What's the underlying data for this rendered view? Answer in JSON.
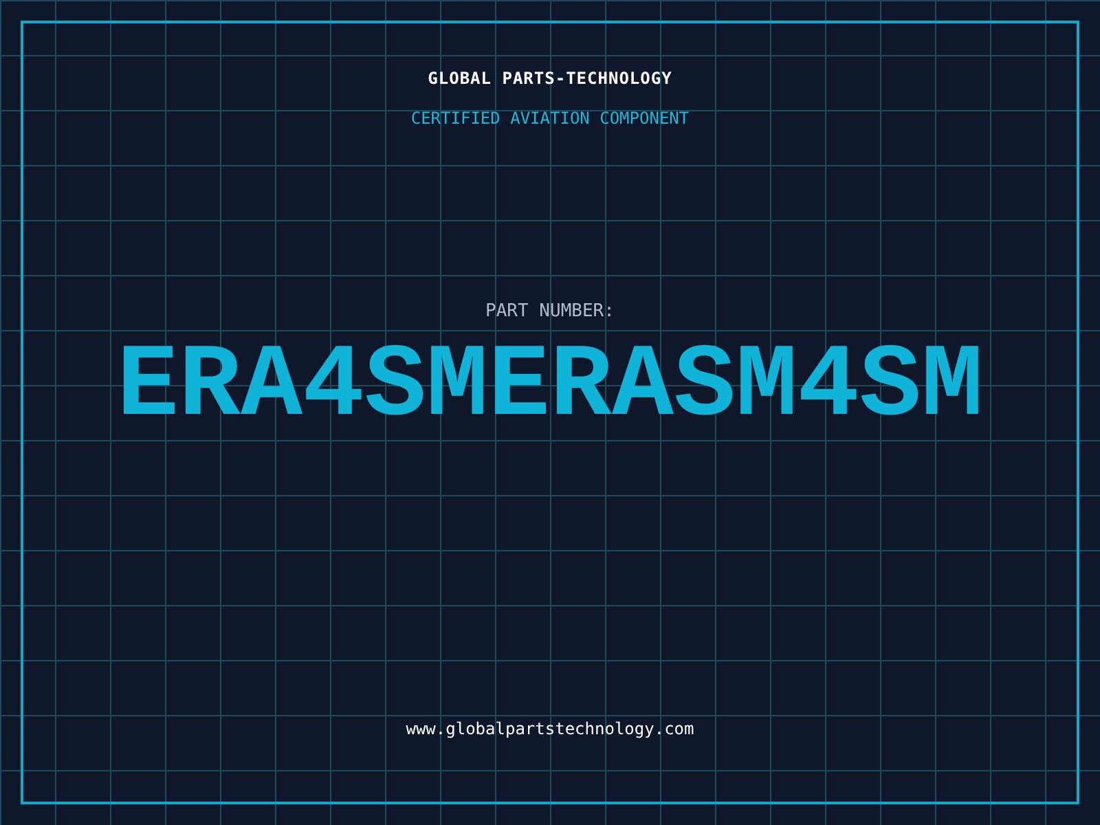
{
  "brand": {
    "title": "GLOBAL PARTS-TECHNOLOGY",
    "subtitle": "CERTIFIED AVIATION COMPONENT"
  },
  "part": {
    "label": "PART NUMBER:",
    "number": "ERA4SMERASM4SM"
  },
  "footer": {
    "url": "www.globalpartstechnology.com"
  }
}
